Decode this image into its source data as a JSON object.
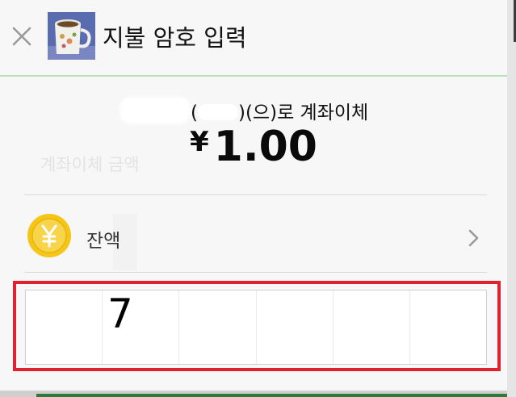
{
  "dialog": {
    "title": "지불 암호 입력",
    "close_icon": "close-icon",
    "avatar": "mug-photo-avatar"
  },
  "transfer": {
    "desc_open": "(",
    "desc_close": ")(으)로 계좌이체",
    "amount_symbol": "¥",
    "amount_value": "1.00"
  },
  "payment_method": {
    "label": "잔액",
    "icon": "yuan-coin-icon",
    "chevron": "chevron-right-icon"
  },
  "pin": {
    "length": 6,
    "digits": [
      "7",
      "",
      "",
      "",
      "",
      ""
    ]
  },
  "background_ghost": {
    "text": "계좌이체 금액"
  },
  "colors": {
    "highlight": "#e0222e",
    "header_divider": "#b6e2b6",
    "coin": "#f5c518",
    "background": "#f7f7f7"
  }
}
